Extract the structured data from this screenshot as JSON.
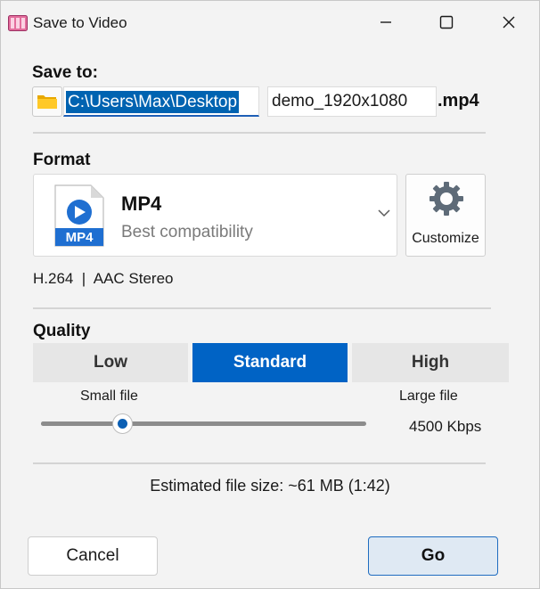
{
  "window": {
    "title": "Save to Video"
  },
  "save_to": {
    "label": "Save to:",
    "path": "C:\\Users\\Max\\Desktop",
    "filename": "demo_1920x1080",
    "extension": ".mp4"
  },
  "format": {
    "label": "Format",
    "icon_label": "MP4",
    "name": "MP4",
    "description": "Best compatibility",
    "customize_label": "Customize",
    "codec_info": "H.264  |  AAC Stereo"
  },
  "quality": {
    "label": "Quality",
    "options": [
      "Low",
      "Standard",
      "High"
    ],
    "selected": "Standard",
    "min_label": "Small file",
    "max_label": "Large file",
    "bitrate": "4500 Kbps",
    "slider_value_fraction": 0.25
  },
  "estimate": "Estimated file size: ~61 MB (1:42)",
  "buttons": {
    "cancel": "Cancel",
    "go": "Go"
  },
  "colors": {
    "accent": "#0063c5",
    "selection": "#0063b1",
    "go_border": "#1f6cc0"
  }
}
